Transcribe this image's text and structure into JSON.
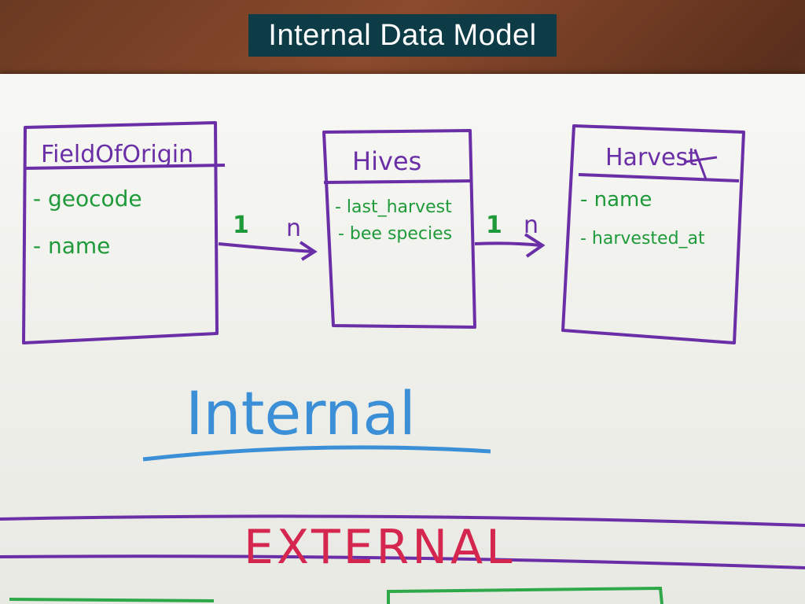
{
  "slide": {
    "title": "Internal Data Model"
  },
  "entities": [
    {
      "name": "FieldOfOrigin",
      "attributes": [
        "- geocode",
        "- name"
      ]
    },
    {
      "name": "Hives",
      "attributes": [
        "- last_harvest",
        "- bee species"
      ]
    },
    {
      "name": "Harvest",
      "attributes": [
        "- name",
        "- harvested_at"
      ]
    }
  ],
  "relationships": [
    {
      "from_label": "1",
      "to_label": "n"
    },
    {
      "from_label": "1",
      "to_label": "n"
    }
  ],
  "sections": {
    "internal_label": "Internal",
    "external_label": "EXTERNAL"
  },
  "colors": {
    "title_bg": "#0d3b46",
    "box_outline": "#6a2fa6",
    "attribute_text": "#1f9a3a",
    "internal_text": "#3b8fd6",
    "external_text": "#d4264f",
    "external_box": "#2fa84a"
  }
}
